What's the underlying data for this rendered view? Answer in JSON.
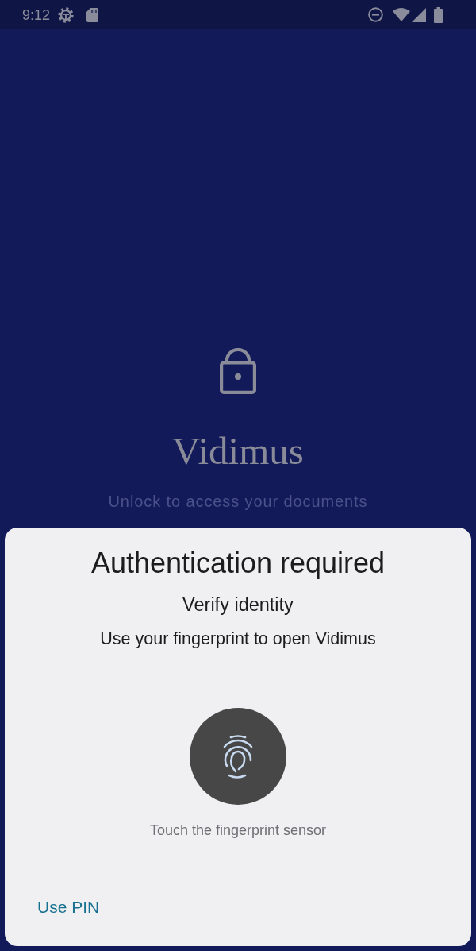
{
  "status_bar": {
    "time": "9:12"
  },
  "lock_screen": {
    "app_name": "Vidimus",
    "subtitle": "Unlock to access your documents"
  },
  "auth_dialog": {
    "title": "Authentication required",
    "subtitle": "Verify identity",
    "description": "Use your fingerprint to open Vidimus",
    "fingerprint_hint": "Touch the fingerprint sensor",
    "negative_button": "Use PIN"
  }
}
